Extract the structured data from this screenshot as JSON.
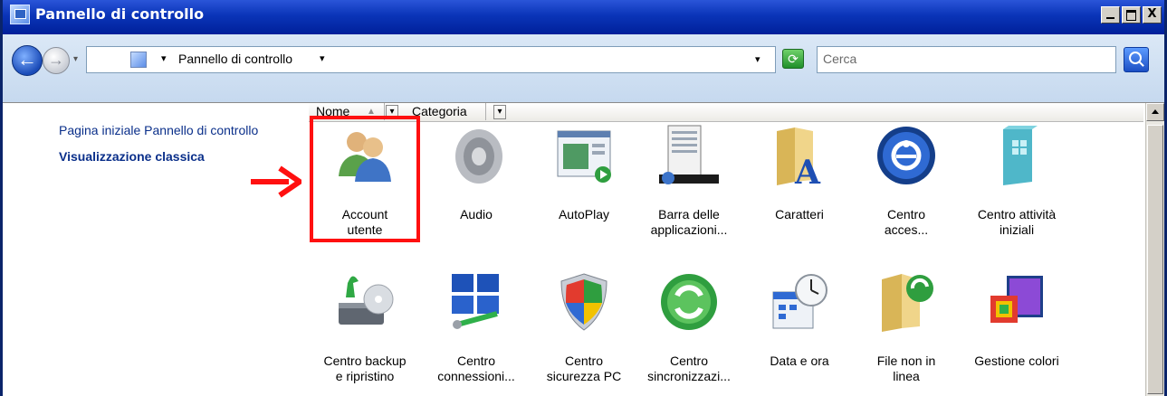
{
  "window": {
    "title": "Pannello di controllo"
  },
  "titlebar_buttons": {
    "minimize": "_",
    "maximize": "",
    "close": "X"
  },
  "addressbar": {
    "path": "Pannello di controllo",
    "chevron": "▾",
    "search_placeholder": "Cerca"
  },
  "tasks": {
    "home_link": "Pagina iniziale Pannello di controllo",
    "classic_view": "Visualizzazione classica"
  },
  "columns": {
    "name": "Nome",
    "sort_arrow": "▲",
    "category": "Categoria",
    "split_arrow": "▾"
  },
  "items": [
    {
      "line1": "Account",
      "line2": "utente",
      "icon": "users-icon"
    },
    {
      "line1": "Audio",
      "line2": "",
      "icon": "speaker-icon"
    },
    {
      "line1": "AutoPlay",
      "line2": "",
      "icon": "autoplay-icon"
    },
    {
      "line1": "Barra delle",
      "line2": "applicazioni...",
      "icon": "taskbar-icon"
    },
    {
      "line1": "Caratteri",
      "line2": "",
      "icon": "fonts-folder-icon"
    },
    {
      "line1": "Centro",
      "line2": "acces...",
      "icon": "accessibility-icon"
    },
    {
      "line1": "Centro attività",
      "line2": "iniziali",
      "icon": "welcome-center-icon"
    },
    {
      "line1": "Centro backup",
      "line2": "e ripristino",
      "icon": "backup-icon"
    },
    {
      "line1": "Centro",
      "line2": "connessioni...",
      "icon": "network-icon"
    },
    {
      "line1": "Centro",
      "line2": "sicurezza PC",
      "icon": "security-shield-icon"
    },
    {
      "line1": "Centro",
      "line2": "sincronizzazi...",
      "icon": "sync-icon"
    },
    {
      "line1": "Data e ora",
      "line2": "",
      "icon": "date-time-icon"
    },
    {
      "line1": "File non in",
      "line2": "linea",
      "icon": "offline-files-icon"
    },
    {
      "line1": "Gestione colori",
      "line2": "",
      "icon": "color-management-icon"
    }
  ],
  "colors": {
    "highlight": "#ff1010",
    "title_bar": "#0a34b8",
    "link": "#0a2f8a"
  }
}
